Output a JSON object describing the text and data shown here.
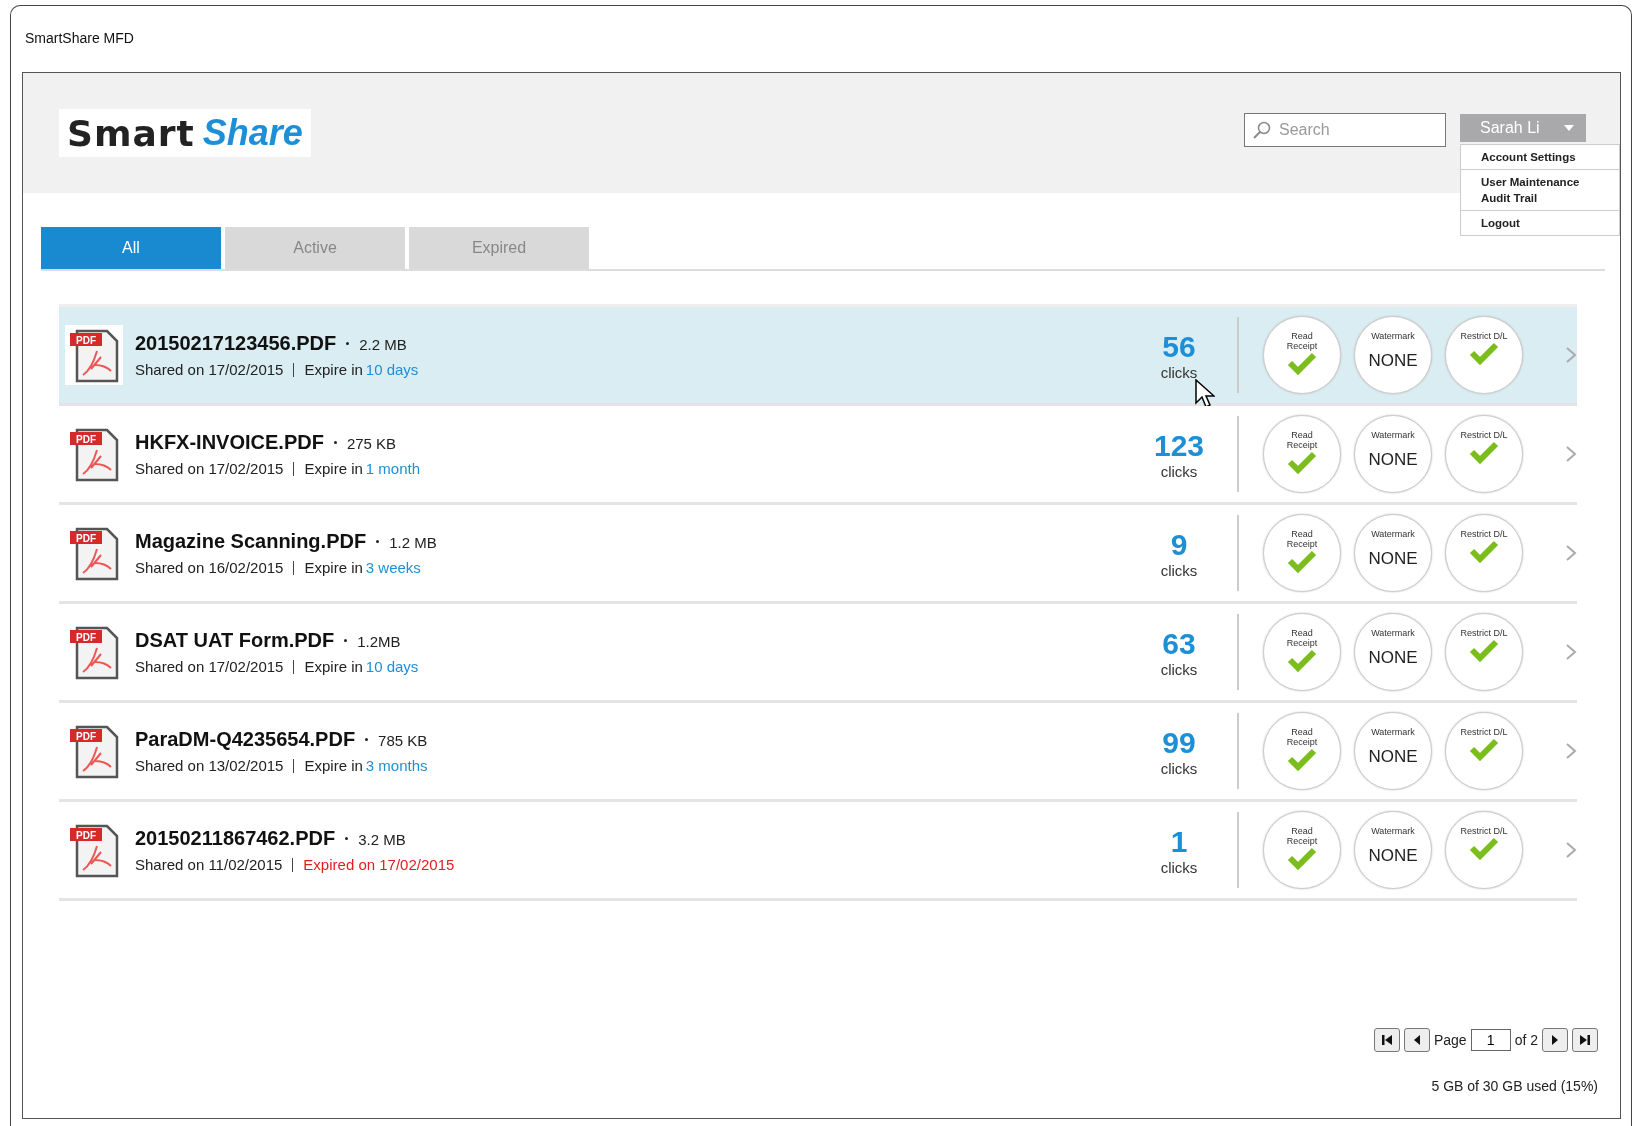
{
  "window": {
    "title": "SmartShare MFD"
  },
  "logo": {
    "part_1": "Smart",
    "part_2": "Share"
  },
  "search": {
    "placeholder": "Search"
  },
  "user_menu": {
    "user": "Sarah Li",
    "expanded": true,
    "sections": [
      {
        "items": [
          "Account Settings"
        ]
      },
      {
        "items": [
          "User Maintenance",
          "Audit Trail"
        ]
      },
      {
        "items": [
          "Logout"
        ]
      }
    ]
  },
  "tabs": [
    {
      "label": "All",
      "selected": true
    },
    {
      "label": "Active",
      "selected": false
    },
    {
      "label": "Expired",
      "selected": false
    }
  ],
  "files": [
    {
      "badge": "PDF",
      "name": "20150217123456.PDF",
      "size": "2.2 MB",
      "shared": "Shared on 17/02/2015",
      "expired": false,
      "expiry_label": "Expire in",
      "expiry": "10 days",
      "clicks": "56",
      "clicks_label": "clicks",
      "selected": true,
      "options": [
        {
          "kind": "check",
          "label": "Read Receipt",
          "checked": true
        },
        {
          "kind": "value",
          "label": "Watermark",
          "value": "NONE"
        },
        {
          "kind": "check",
          "label": "Restrict D/L",
          "checked": true
        }
      ]
    },
    {
      "badge": "PDF",
      "name": "HKFX-INVOICE.PDF",
      "size": "275 KB",
      "shared": "Shared on 17/02/2015",
      "expired": false,
      "expiry_label": "Expire in",
      "expiry": "1 month",
      "clicks": "123",
      "clicks_label": "clicks",
      "selected": false,
      "options": [
        {
          "kind": "check",
          "label": "Read Receipt",
          "checked": true
        },
        {
          "kind": "value",
          "label": "Watermark",
          "value": "NONE"
        },
        {
          "kind": "check",
          "label": "Restrict D/L",
          "checked": true
        }
      ]
    },
    {
      "badge": "PDF",
      "name": "Magazine Scanning.PDF",
      "size": "1.2 MB",
      "shared": "Shared on 16/02/2015",
      "expired": false,
      "expiry_label": "Expire in",
      "expiry": "3 weeks",
      "clicks": "9",
      "clicks_label": "clicks",
      "selected": false,
      "options": [
        {
          "kind": "check",
          "label": "Read Receipt",
          "checked": true
        },
        {
          "kind": "value",
          "label": "Watermark",
          "value": "NONE"
        },
        {
          "kind": "check",
          "label": "Restrict D/L",
          "checked": true
        }
      ]
    },
    {
      "badge": "PDF",
      "name": "DSAT UAT Form.PDF",
      "size": "1.2MB",
      "shared": "Shared on 17/02/2015",
      "expired": false,
      "expiry_label": "Expire in",
      "expiry": "10 days",
      "clicks": "63",
      "clicks_label": "clicks",
      "selected": false,
      "options": [
        {
          "kind": "check",
          "label": "Read Receipt",
          "checked": true
        },
        {
          "kind": "value",
          "label": "Watermark",
          "value": "NONE"
        },
        {
          "kind": "check",
          "label": "Restrict D/L",
          "checked": true
        }
      ]
    },
    {
      "badge": "PDF",
      "name": "ParaDM-Q4235654.PDF",
      "size": "785 KB",
      "shared": "Shared on 13/02/2015",
      "expired": false,
      "expiry_label": "Expire in",
      "expiry": "3 months",
      "clicks": "99",
      "clicks_label": "clicks",
      "selected": false,
      "options": [
        {
          "kind": "check",
          "label": "Read Receipt",
          "checked": true
        },
        {
          "kind": "value",
          "label": "Watermark",
          "value": "NONE"
        },
        {
          "kind": "check",
          "label": "Restrict D/L",
          "checked": true
        }
      ]
    },
    {
      "badge": "PDF",
      "name": "20150211867462.PDF",
      "size": "3.2 MB",
      "shared": "Shared on 11/02/2015",
      "expired": true,
      "expiry": "Expired on 17/02/2015",
      "clicks": "1",
      "clicks_label": "clicks",
      "selected": false,
      "options": [
        {
          "kind": "check",
          "label": "Read Receipt",
          "checked": true
        },
        {
          "kind": "value",
          "label": "Watermark",
          "value": "NONE"
        },
        {
          "kind": "check",
          "label": "Restrict D/L",
          "checked": true
        }
      ]
    }
  ],
  "pagination": {
    "page_label": "Page",
    "page": "1",
    "of": "of 2"
  },
  "storage": "5 GB of 30 GB used (15%)"
}
